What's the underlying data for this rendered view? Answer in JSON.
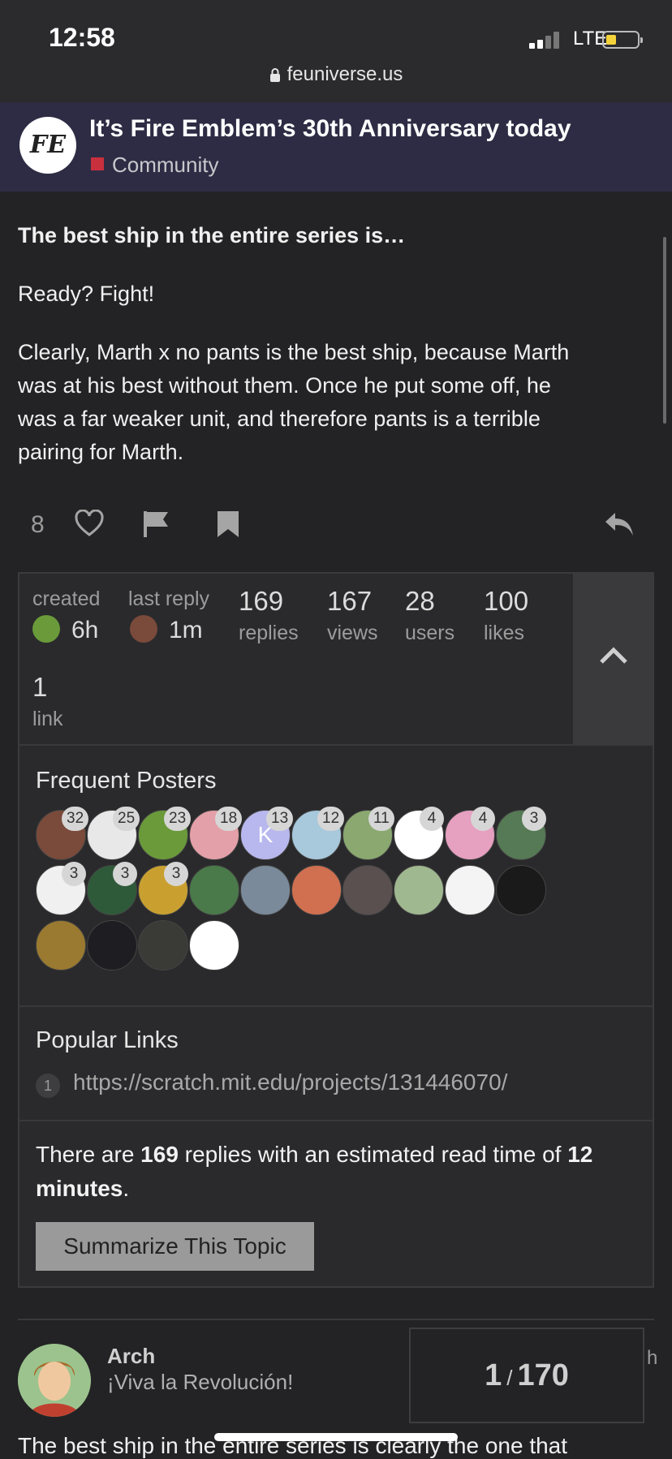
{
  "status_bar": {
    "time": "12:58",
    "network": "LTE",
    "url": "feuniverse.us"
  },
  "header": {
    "logo_text": "FE",
    "topic_title": "It’s Fire Emblem’s 30th Anniversary today",
    "category": "Community",
    "category_color": "#c9303e"
  },
  "post": {
    "heading": "The best ship in the entire series is…",
    "line1": "Ready? Fight!",
    "paragraph_lines": [
      "Clearly, Marth x no pants is the best ship, because Marth",
      "was at his best without them. Once he put some off, he",
      "was a far weaker unit, and therefore pants is a terrible",
      "pairing for Marth."
    ],
    "like_count": "8"
  },
  "topic_map": {
    "created_label": "created",
    "created_value": "6h",
    "last_reply_label": "last reply",
    "last_reply_value": "1m",
    "replies_num": "169",
    "replies_label": "replies",
    "views_num": "167",
    "views_label": "views",
    "users_num": "28",
    "users_label": "users",
    "likes_num": "100",
    "likes_label": "likes",
    "links_num": "1",
    "links_label": "link"
  },
  "frequent_posters": {
    "title": "Frequent Posters",
    "posters": [
      {
        "count": "32",
        "color": "#7a4a3a"
      },
      {
        "count": "25",
        "color": "#e8e8e8"
      },
      {
        "count": "23",
        "color": "#6a9a3a"
      },
      {
        "count": "18",
        "color": "#e3a0a8"
      },
      {
        "count": "13",
        "color": "#b8b8ee",
        "letter": "K"
      },
      {
        "count": "12",
        "color": "#a8c8dc"
      },
      {
        "count": "11",
        "color": "#8aa870"
      },
      {
        "count": "4",
        "color": "#ffffff"
      },
      {
        "count": "4",
        "color": "#e6a0c0"
      },
      {
        "count": "3",
        "color": "#557a55"
      },
      {
        "count": "3",
        "color": "#f0f0f0"
      },
      {
        "count": "3",
        "color": "#2f5a3a"
      },
      {
        "count": "3",
        "color": "#c9a030"
      },
      {
        "count": "",
        "color": "#4a7a4a"
      },
      {
        "count": "",
        "color": "#7a8a9a"
      },
      {
        "count": "",
        "color": "#d07050"
      },
      {
        "count": "",
        "color": "#5a5050"
      },
      {
        "count": "",
        "color": "#a0b890"
      },
      {
        "count": "",
        "color": "#f4f4f4"
      },
      {
        "count": "",
        "color": "#1a1a1a"
      },
      {
        "count": "",
        "color": "#9a7a30"
      },
      {
        "count": "",
        "color": "#1e1e22"
      },
      {
        "count": "",
        "color": "#3a3a36"
      },
      {
        "count": "",
        "color": "#ffffff"
      }
    ]
  },
  "popular_links": {
    "title": "Popular Links",
    "items": [
      {
        "num": "1",
        "url": "https://scratch.mit.edu/projects/131446070/"
      }
    ]
  },
  "summary": {
    "text_a": "There are ",
    "replies": "169",
    "text_b": " replies with an estimated read time of ",
    "minutes": "12",
    "text_c": "minutes",
    "text_d": ".",
    "button": "Summarize This Topic"
  },
  "reply": {
    "username": "Arch",
    "user_title": "¡Viva la Revolución!",
    "body_start": "The best ship in the entire series is clearly the one that",
    "edge_text": "h"
  },
  "progress": {
    "current": "1",
    "separator": "/",
    "total": "170"
  }
}
